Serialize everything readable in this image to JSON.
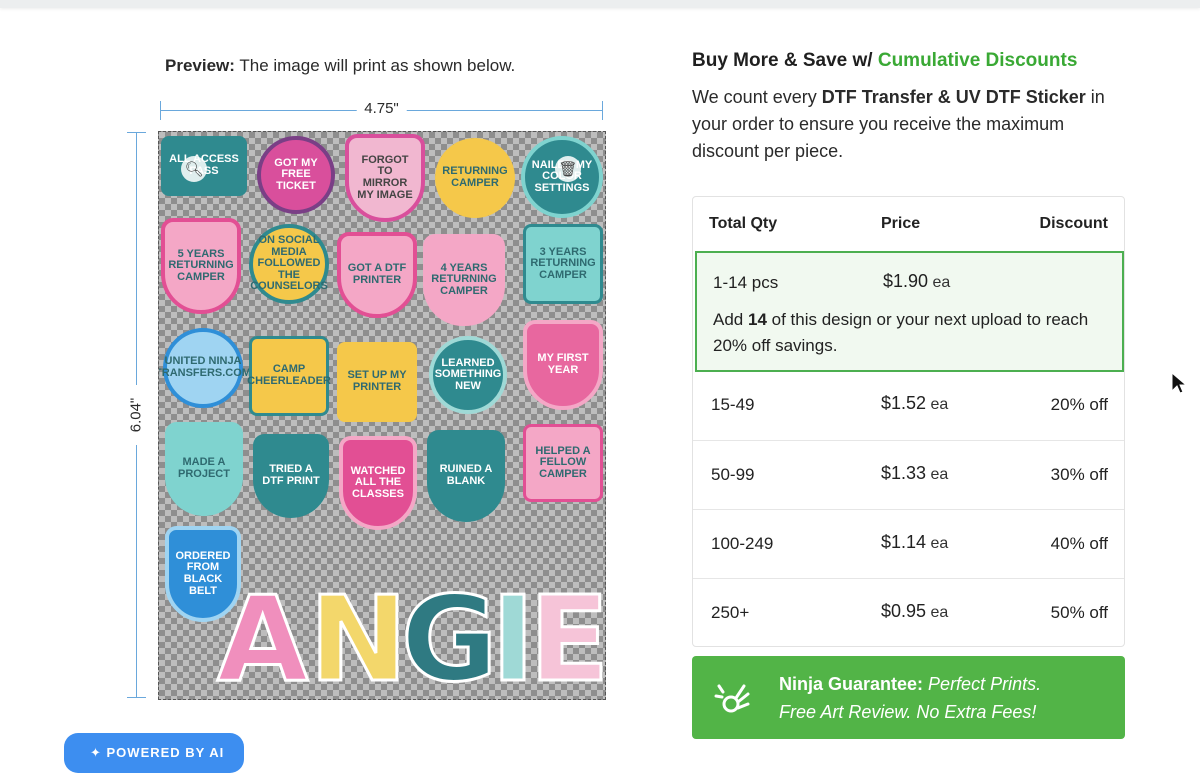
{
  "preview": {
    "caption_bold": "Preview:",
    "caption_text": " The image will print as shown below.",
    "width_label": "4.75\"",
    "height_label": "6.04\""
  },
  "stickers": [
    {
      "text": "ALL ACCESS PASS",
      "color": "#2f8a8f"
    },
    {
      "text": "GOT MY FREE TICKET",
      "color": "#d94f9c"
    },
    {
      "text": "FORGOT TO MIRROR MY IMAGE",
      "color": "#f1b7d0"
    },
    {
      "text": "RETURNING CAMPER",
      "color": "#f5c84a"
    },
    {
      "text": "NAILED MY COLOR SETTINGS",
      "color": "#2f8a8f"
    },
    {
      "text": "5 YEARS RETURNING CAMPER",
      "color": "#f4a7c6"
    },
    {
      "text": "ON SOCIAL MEDIA FOLLOWED THE COUNSELORS",
      "color": "#f5c84a"
    },
    {
      "text": "GOT A DTF PRINTER",
      "color": "#f4a7c6"
    },
    {
      "text": "4 YEARS RETURNING CAMPER",
      "color": "#f4a7c6"
    },
    {
      "text": "3 YEARS RETURNING CAMPER",
      "color": "#7fd3cf"
    },
    {
      "text": "UNITED NINJA TRANSFERS.COM",
      "color": "#9fd4f2"
    },
    {
      "text": "CAMP CHEERLEADER",
      "color": "#f5c84a"
    },
    {
      "text": "SET UP MY PRINTER",
      "color": "#f5c84a"
    },
    {
      "text": "LEARNED SOMETHING NEW",
      "color": "#2f8a8f"
    },
    {
      "text": "MY FIRST YEAR",
      "color": "#e8679f"
    },
    {
      "text": "MADE A PROJECT",
      "color": "#7fd3cf"
    },
    {
      "text": "TRIED A DTF PRINT",
      "color": "#2f8a8f"
    },
    {
      "text": "WATCHED ALL THE CLASSES",
      "color": "#e24f94"
    },
    {
      "text": "RUINED A BLANK",
      "color": "#2f8a8f"
    },
    {
      "text": "HELPED A FELLOW CAMPER",
      "color": "#f4a7c6"
    },
    {
      "text": "ORDERED FROM BLACK BELT",
      "color": "#2f8fd8"
    }
  ],
  "name_letters": [
    {
      "letter": "A",
      "color": "#f08fbd"
    },
    {
      "letter": "N",
      "color": "#f3d76b"
    },
    {
      "letter": "G",
      "color": "#2f7a82"
    },
    {
      "letter": "I",
      "color": "#9fd9d6"
    },
    {
      "letter": "E",
      "color": "#f6c4d8"
    }
  ],
  "ai_button": {
    "label": "POWERED BY AI"
  },
  "discounts": {
    "heading_prefix": "Buy More & Save w/ ",
    "heading_highlight": "Cumulative Discounts",
    "intro_1": "We count every ",
    "intro_bold": "DTF Transfer & UV DTF Sticker",
    "intro_2": " in your order to ensure you receive the maximum discount per piece.",
    "headers": {
      "qty": "Total Qty",
      "price": "Price",
      "discount": "Discount"
    },
    "active_tier": {
      "qty": "1-14 pcs",
      "price": "$1.90",
      "unit": " ea",
      "msg_1": "Add ",
      "msg_bold": "14",
      "msg_2": " of this design or your next upload to reach 20% off savings."
    },
    "tiers": [
      {
        "qty": "15-49",
        "price": "$1.52",
        "unit": " ea",
        "discount": "20% off"
      },
      {
        "qty": "50-99",
        "price": "$1.33",
        "unit": " ea",
        "discount": "30% off"
      },
      {
        "qty": "100-249",
        "price": "$1.14",
        "unit": " ea",
        "discount": "40% off"
      },
      {
        "qty": "250+",
        "price": "$0.95",
        "unit": " ea",
        "discount": "50% off"
      }
    ]
  },
  "guarantee": {
    "bold": "Ninja Guarantee:",
    "italic_1": " Perfect Prints.",
    "line_2": "Free Art Review. No Extra Fees!"
  }
}
